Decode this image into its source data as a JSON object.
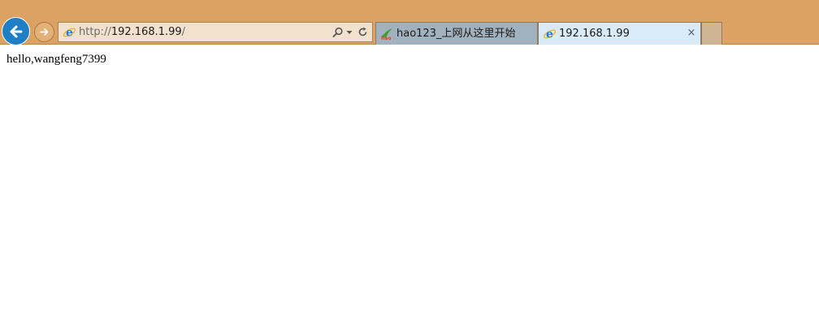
{
  "browser": {
    "address_bar": {
      "url_prefix": "http://",
      "url_host": "192.168.1.99",
      "url_suffix": "/"
    },
    "tabs": [
      {
        "label": "hao123_上网从这里开始",
        "icon": "hao123-icon",
        "active": false
      },
      {
        "label": "192.168.1.99",
        "icon": "ie-icon",
        "active": true,
        "close_glyph": "×"
      }
    ]
  },
  "page": {
    "text": "hello,wangfeng7399"
  },
  "colors": {
    "chrome_bg": "#dba263",
    "back_button": "#1e7fc7",
    "address_bar_bg": "#f2e1cc",
    "inactive_tab": "#a1b1be",
    "active_tab": "#daeaf7",
    "page_bg": "#ffffff"
  }
}
